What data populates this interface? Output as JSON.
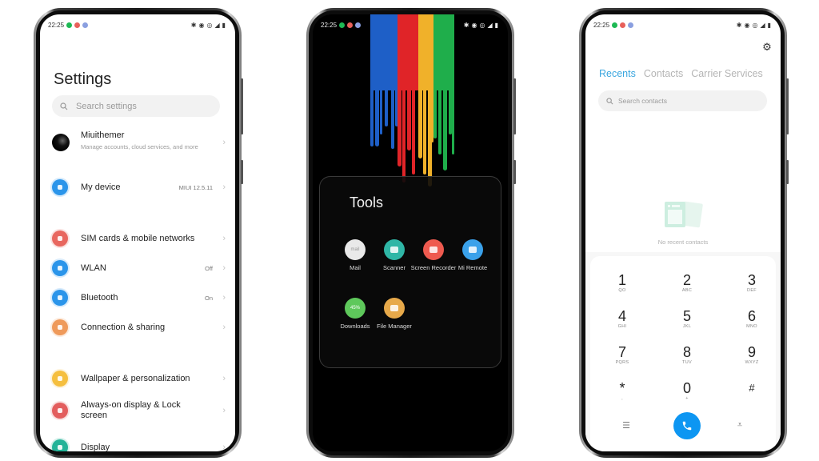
{
  "status_bar": {
    "time": "22:25",
    "notification_dots": [
      "#1db954",
      "#e8605a",
      "#8a9fe0"
    ],
    "right_icons": [
      "bluetooth-icon",
      "vibrate-icon",
      "hotspot-icon",
      "signal-icon",
      "battery-icon"
    ]
  },
  "settings": {
    "title": "Settings",
    "search_placeholder": "Search settings",
    "account": {
      "name": "Miuithemer",
      "subtitle": "Manage accounts, cloud services, and more"
    },
    "items": [
      {
        "label": "My device",
        "value": "MIUI 12.5.11",
        "color": "#2b95ea",
        "icon": "device-icon"
      },
      {
        "label": "SIM cards & mobile networks",
        "value": "",
        "color": "#e8675f",
        "icon": "sim-icon"
      },
      {
        "label": "WLAN",
        "value": "Off",
        "color": "#2b95ea",
        "icon": "wifi-icon"
      },
      {
        "label": "Bluetooth",
        "value": "On",
        "color": "#2b95ea",
        "icon": "bluetooth-icon"
      },
      {
        "label": "Connection & sharing",
        "value": "",
        "color": "#ef9a5b",
        "icon": "connection-icon"
      },
      {
        "label": "Wallpaper & personalization",
        "value": "",
        "color": "#f5bf3f",
        "icon": "wallpaper-icon"
      },
      {
        "label": "Always-on display & Lock screen",
        "value": "",
        "color": "#e35e5e",
        "icon": "lock-icon"
      },
      {
        "label": "Display",
        "value": "",
        "color": "#22b398",
        "icon": "display-icon"
      }
    ]
  },
  "tools": {
    "title": "Tools",
    "wallpaper_colors": [
      "#1e5fc7",
      "#e02428",
      "#f0b12a",
      "#1fae4b"
    ],
    "apps": [
      {
        "name": "Mail",
        "color": "#e9e9e9",
        "icon": "mail-icon",
        "badge": "mail"
      },
      {
        "name": "Scanner",
        "color": "#2fb6a6",
        "icon": "scanner-icon",
        "badge": ""
      },
      {
        "name": "Screen Recorder",
        "color": "#ee5a4f",
        "icon": "screen-recorder-icon",
        "badge": ""
      },
      {
        "name": "Mi Remote",
        "color": "#3aa1ea",
        "icon": "mi-remote-icon",
        "badge": ""
      },
      {
        "name": "Downloads",
        "color": "#5ec85b",
        "icon": "downloads-icon",
        "badge": "45%"
      },
      {
        "name": "File Manager",
        "color": "#e7a94a",
        "icon": "file-manager-icon",
        "badge": ""
      }
    ]
  },
  "dialer": {
    "tabs": [
      {
        "label": "Recents",
        "active": true
      },
      {
        "label": "Contacts",
        "active": false
      },
      {
        "label": "Carrier Services",
        "active": false
      }
    ],
    "search_placeholder": "Search contacts",
    "empty_text": "No recent contacts",
    "accent": "#3aa6df",
    "call_color": "#0d96f2",
    "keys": [
      {
        "digit": "1",
        "letters": "QO"
      },
      {
        "digit": "2",
        "letters": "ABC"
      },
      {
        "digit": "3",
        "letters": "DEF"
      },
      {
        "digit": "4",
        "letters": "GHI"
      },
      {
        "digit": "5",
        "letters": "JKL"
      },
      {
        "digit": "6",
        "letters": "MNO"
      },
      {
        "digit": "7",
        "letters": "PQRS"
      },
      {
        "digit": "8",
        "letters": "TUV"
      },
      {
        "digit": "9",
        "letters": "WXYZ"
      },
      {
        "digit": "*",
        "letters": ","
      },
      {
        "digit": "0",
        "letters": "+"
      },
      {
        "digit": "#",
        "letters": ""
      }
    ]
  }
}
